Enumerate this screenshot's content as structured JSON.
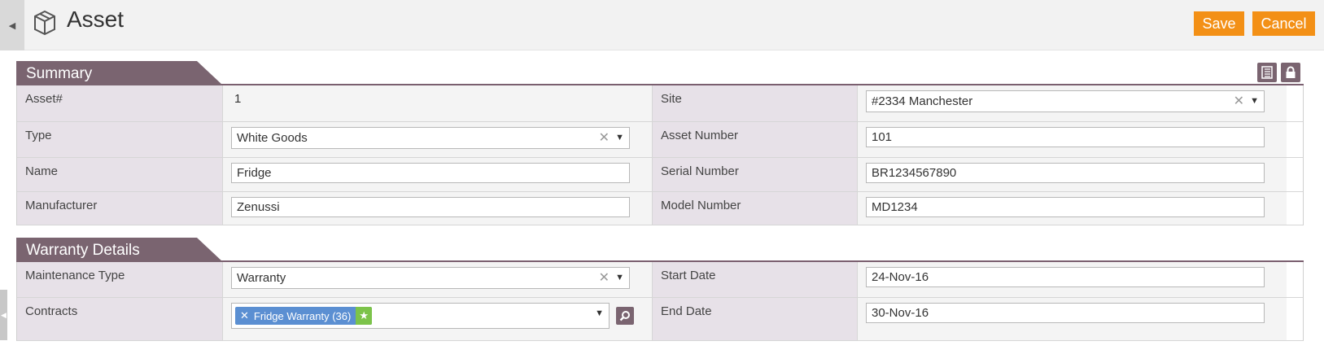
{
  "header": {
    "title": "Asset",
    "save_label": "Save",
    "cancel_label": "Cancel"
  },
  "summary": {
    "title": "Summary",
    "asset_no_label": "Asset#",
    "asset_no_value": "1",
    "site_label": "Site",
    "site_value": "#2334 Manchester",
    "type_label": "Type",
    "type_value": "White Goods",
    "asset_number_label": "Asset Number",
    "asset_number_value": "101",
    "name_label": "Name",
    "name_value": "Fridge",
    "serial_label": "Serial Number",
    "serial_value": "BR1234567890",
    "manufacturer_label": "Manufacturer",
    "manufacturer_value": "Zenussi",
    "model_label": "Model Number",
    "model_value": "MD1234"
  },
  "warranty": {
    "title": "Warranty Details",
    "maint_type_label": "Maintenance Type",
    "maint_type_value": "Warranty",
    "start_label": "Start Date",
    "start_value": "24-Nov-16",
    "contracts_label": "Contracts",
    "contract_tag": "Fridge Warranty (36)",
    "end_label": "End Date",
    "end_value": "30-Nov-16"
  },
  "icons": {
    "app": "cube-icon",
    "clear": "clear-icon",
    "dropdown": "caret-down-icon",
    "search": "search-icon",
    "star": "star-icon",
    "list": "list-icon",
    "lock": "lock-icon"
  },
  "colors": {
    "accent": "#f39016",
    "section": "#7a6470",
    "label_bg": "#e7e1e8",
    "tag": "#5b8fd2",
    "tag_star": "#7cc34a"
  }
}
